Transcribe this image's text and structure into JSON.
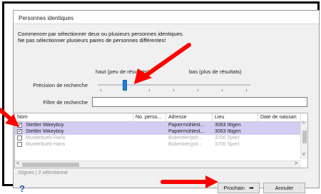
{
  "dialog": {
    "title": "Personnes identiques",
    "intro_line1": "Commencer par sélectionner deux ou plusieurs personnes identiques.",
    "intro_line2": "Ne pas sélectionner plusieurs paires de personnes différentes!"
  },
  "precision": {
    "low_label": "haut (peu de résultats)",
    "high_label": "bas (plus de résultats)",
    "label": "Précision de recherche"
  },
  "filter": {
    "label": "Filtre de recherche",
    "value": ""
  },
  "table": {
    "columns": [
      "Nom",
      "No. perso...",
      "Adresse",
      "Lieu",
      "Date de naissan"
    ],
    "rows": [
      {
        "checked": "✓",
        "nom": "Stettler Mikeyboy",
        "no": "",
        "adresse": "Papiermühlest...",
        "lieu": "3063 Ittigen",
        "date": ""
      },
      {
        "checked": "✓",
        "nom": "Stettler Mikeyboy",
        "no": "",
        "adresse": "Papiermühlest...",
        "lieu": "3063 Ittigen",
        "date": ""
      },
      {
        "checked": "",
        "nom": "Musterbueb Hans",
        "no": "",
        "adresse": "Bubenbergstr...",
        "lieu": "3700 Spiez",
        "date": ""
      },
      {
        "checked": "",
        "nom": "Musterbueb Hans",
        "no": "",
        "adresse": "Bubenbergstr...",
        "lieu": "3700 Spiez",
        "date": ""
      }
    ]
  },
  "status": "10gnes | 2 sélectionné",
  "buttons": {
    "help": "?",
    "next": "Prochain",
    "next_arrow": "➡",
    "cancel": "Annuler"
  },
  "colors": {
    "selected_row": "#d4ccf2",
    "slider_thumb": "#1e7fe0",
    "annotation_arrow": "#ff0000"
  }
}
